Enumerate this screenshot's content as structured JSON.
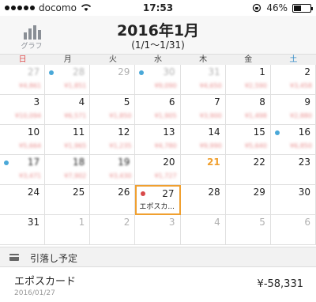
{
  "status_bar": {
    "carrier": "docomo",
    "time": "17:53",
    "battery": "46%",
    "battery_level": 0.46
  },
  "header": {
    "graph_label": "グラフ",
    "title": "2016年1月",
    "range": "(1/1〜1/31)"
  },
  "weekdays": [
    "日",
    "月",
    "火",
    "水",
    "木",
    "金",
    "土"
  ],
  "weekday_colors": {
    "sun": "#e05050",
    "sat": "#3a90c8",
    "other": "#444444"
  },
  "calendar": {
    "weeks": [
      [
        {
          "day": "27",
          "dim": true,
          "amount": "¥4,861",
          "blur": true
        },
        {
          "day": "28",
          "dim": true,
          "amount": "¥1,851",
          "dot": "blue",
          "blur": true
        },
        {
          "day": "29",
          "dim": true,
          "amount": "",
          "blur": false
        },
        {
          "day": "30",
          "dim": true,
          "amount": "¥9,090",
          "dot": "blue",
          "blur": true
        },
        {
          "day": "31",
          "dim": true,
          "amount": "¥4,650",
          "blur": true
        },
        {
          "day": "1",
          "dim": false,
          "amount": "¥2,590",
          "blur": false
        },
        {
          "day": "2",
          "dim": false,
          "amount": "¥3,458",
          "blur": false
        }
      ],
      [
        {
          "day": "3",
          "dim": false,
          "amount": "¥10,094",
          "blur": false
        },
        {
          "day": "4",
          "dim": false,
          "amount": "¥6,571",
          "blur": false
        },
        {
          "day": "5",
          "dim": false,
          "amount": "¥1,850",
          "blur": false
        },
        {
          "day": "6",
          "dim": false,
          "amount": "¥1,905",
          "blur": false
        },
        {
          "day": "7",
          "dim": false,
          "amount": "¥3,900",
          "blur": false
        },
        {
          "day": "8",
          "dim": false,
          "amount": "¥1,498",
          "blur": false
        },
        {
          "day": "9",
          "dim": false,
          "amount": "¥2,880",
          "blur": false
        }
      ],
      [
        {
          "day": "10",
          "dim": false,
          "amount": "¥5,664",
          "blur": false
        },
        {
          "day": "11",
          "dim": false,
          "amount": "¥1,965",
          "blur": false
        },
        {
          "day": "12",
          "dim": false,
          "amount": "¥1,235",
          "blur": false
        },
        {
          "day": "13",
          "dim": false,
          "amount": "¥4,780",
          "blur": false
        },
        {
          "day": "14",
          "dim": false,
          "amount": "¥9,990",
          "blur": false
        },
        {
          "day": "15",
          "dim": false,
          "amount": "¥5,640",
          "blur": false
        },
        {
          "day": "16",
          "dim": false,
          "amount": "¥6,850",
          "dot": "blue",
          "blur": false
        }
      ],
      [
        {
          "day": "17",
          "dim": false,
          "amount": "¥3,471",
          "dot": "blue",
          "blur": true
        },
        {
          "day": "18",
          "dim": false,
          "amount": "¥7,902",
          "blur": true
        },
        {
          "day": "19",
          "dim": false,
          "amount": "¥3,430",
          "blur": true
        },
        {
          "day": "20",
          "dim": false,
          "amount": "¥1,727",
          "blur": false
        },
        {
          "day": "21",
          "dim": false,
          "amount": "",
          "today": true,
          "blur": false
        },
        {
          "day": "22",
          "dim": false,
          "amount": "",
          "blur": false
        },
        {
          "day": "23",
          "dim": false,
          "amount": "",
          "blur": false
        }
      ],
      [
        {
          "day": "24",
          "dim": false,
          "amount": "",
          "blur": false
        },
        {
          "day": "25",
          "dim": false,
          "amount": "",
          "blur": false
        },
        {
          "day": "26",
          "dim": false,
          "amount": "",
          "blur": false
        },
        {
          "day": "27",
          "dim": false,
          "amount": "",
          "dot": "red",
          "event": "エポスカ...",
          "selected": true,
          "blur": false
        },
        {
          "day": "28",
          "dim": false,
          "amount": "",
          "blur": false
        },
        {
          "day": "29",
          "dim": false,
          "amount": "",
          "blur": false
        },
        {
          "day": "30",
          "dim": false,
          "amount": "",
          "blur": false
        }
      ],
      [
        {
          "day": "31",
          "dim": false,
          "amount": "",
          "blur": false
        },
        {
          "day": "1",
          "dim": true,
          "amount": "",
          "blur": false
        },
        {
          "day": "2",
          "dim": true,
          "amount": "",
          "blur": false
        },
        {
          "day": "3",
          "dim": true,
          "amount": "",
          "blur": false
        },
        {
          "day": "4",
          "dim": true,
          "amount": "",
          "blur": false
        },
        {
          "day": "5",
          "dim": true,
          "amount": "",
          "blur": false
        },
        {
          "day": "6",
          "dim": true,
          "amount": "",
          "blur": false
        }
      ]
    ]
  },
  "section": {
    "label": "引落し予定",
    "icon": "credit-card-icon"
  },
  "entry": {
    "name": "エポスカード",
    "date": "2016/01/27",
    "amount": "¥-58,331"
  }
}
